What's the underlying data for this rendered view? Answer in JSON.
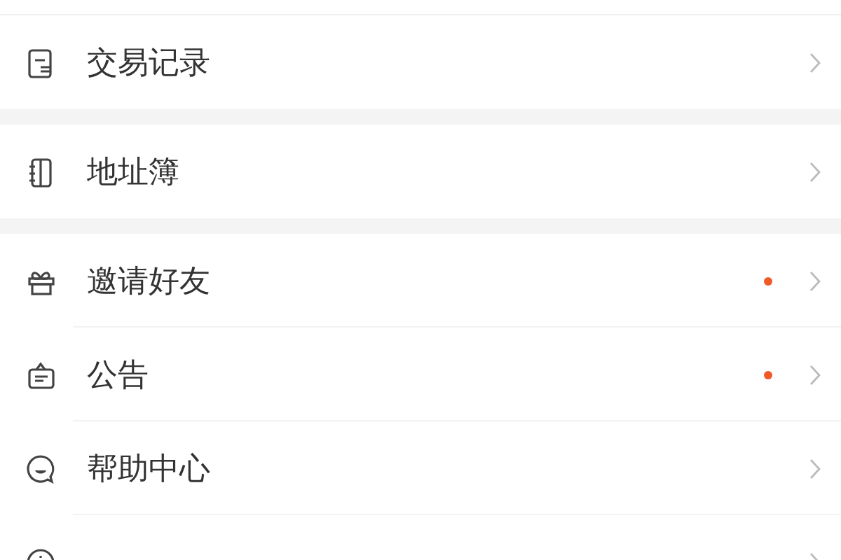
{
  "groups": [
    {
      "items": [
        {
          "kind": "receipt",
          "label": "交易记录",
          "badge": false
        }
      ]
    },
    {
      "items": [
        {
          "kind": "notebook",
          "label": "地址簿",
          "badge": false
        }
      ]
    },
    {
      "items": [
        {
          "kind": "gift",
          "label": "邀请好友",
          "badge": true
        },
        {
          "kind": "notice",
          "label": "公告",
          "badge": true
        },
        {
          "kind": "help",
          "label": "帮助中心",
          "badge": false
        },
        {
          "kind": "info",
          "badge": false
        }
      ]
    }
  ]
}
